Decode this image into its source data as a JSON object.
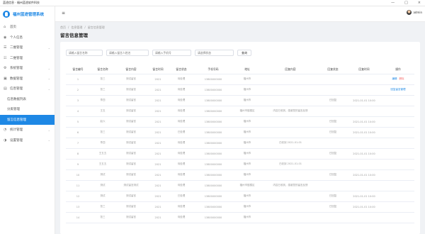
{
  "window": {
    "title": "蓝途信息 · 福州蓝途软件科技",
    "controls": [
      "—",
      "□",
      "×"
    ]
  },
  "app": {
    "name": "福州蓝途管理系统"
  },
  "sidebar": {
    "items": [
      {
        "name": "home",
        "icon": "⌂",
        "label": "首页",
        "chevron": ""
      },
      {
        "name": "personal",
        "icon": "◉",
        "label": "个人信息",
        "chevron": ""
      },
      {
        "name": "menu3",
        "icon": "☰",
        "label": "二维管理",
        "chevron": "⌄"
      },
      {
        "name": "menu4",
        "icon": "☷",
        "label": "二维管理",
        "chevron": ""
      },
      {
        "name": "menu5",
        "icon": "⚙",
        "label": "系统管理",
        "chevron": "⌄"
      },
      {
        "name": "menu6",
        "icon": "▣",
        "label": "数据管理",
        "chevron": "⌄"
      },
      {
        "name": "menu7",
        "icon": "▤",
        "label": "信息管理",
        "chevron": "⌄"
      },
      {
        "name": "sub1",
        "icon": "",
        "label": "信息数据列表",
        "chevron": ""
      },
      {
        "name": "sub2",
        "icon": "",
        "label": "分类管理",
        "chevron": ""
      },
      {
        "name": "sub3",
        "icon": "",
        "label": "留言信息管理",
        "chevron": "",
        "active": true
      },
      {
        "name": "menu8",
        "icon": "◔",
        "label": "统计管理",
        "chevron": "⌄"
      },
      {
        "name": "menu9",
        "icon": "◑",
        "label": "设置管理",
        "chevron": "⌄"
      }
    ]
  },
  "topbar": {
    "menu_icon": "≡",
    "user_name": "admin"
  },
  "breadcrumb": [
    "首页",
    "/",
    "信息管理",
    "/",
    "留言信息管理"
  ],
  "page": {
    "title": "留言信息管理"
  },
  "filters": {
    "inputs": [
      {
        "placeholder": "请输入留言名称"
      },
      {
        "placeholder": "请输入留言人姓名"
      },
      {
        "placeholder": "请输入手机号"
      },
      {
        "placeholder": "请选择状态"
      }
    ],
    "search_label": "查询"
  },
  "table": {
    "columns": [
      "留言编号",
      "留言名称",
      "留言内容",
      "留言时间",
      "留言状态",
      "手机号码",
      "地址",
      "回复内容",
      "回复状态",
      "回复时间",
      "操作"
    ],
    "rows": [
      [
        "1",
        "张三",
        "测试留言",
        "2021",
        "待处理",
        "13800000000",
        "福州市",
        "",
        "",
        "",
        "edit-del"
      ],
      [
        "2",
        "张三",
        "测试留言",
        "2021",
        "待处理",
        "13800000000",
        "福州市",
        "",
        "",
        "",
        "reply"
      ],
      [
        "3",
        "李四",
        "测试留言",
        "2021",
        "待处理",
        "13800000000",
        "福州市",
        "",
        "已回复",
        "2021-01-01 10:00",
        ""
      ],
      [
        "4",
        "王五",
        "测试留言",
        "2021",
        "待处理",
        "13800000000",
        "福州市鼓楼区",
        "内容已收到，感谢您的留言反馈",
        "",
        "",
        ""
      ],
      [
        "5",
        "赵六",
        "测试留言",
        "2021",
        "待处理",
        "13800000000",
        "福州市",
        "",
        "已回复",
        "2021-01-01 10:00",
        ""
      ],
      [
        "6",
        "张三",
        "测试留言",
        "2021",
        "已处理",
        "13800000000",
        "福州市",
        "",
        "已回复",
        "2021-01-01 10:00",
        ""
      ],
      [
        "7",
        "李四",
        "测试留言",
        "2021",
        "待处理",
        "13800000000",
        "福州市",
        "已收到 2021-01-01",
        "",
        "",
        ""
      ],
      [
        "8",
        "王五五",
        "测试留言",
        "2021",
        "待处理",
        "13800000000",
        "福州市",
        "",
        "已回复",
        "2021-01-01 10:00",
        ""
      ],
      [
        "9",
        "王五五",
        "测试留言",
        "2021",
        "待处理",
        "13800000000",
        "福州市",
        "已收到 2021-01-01",
        "",
        "",
        ""
      ],
      [
        "10",
        "测试",
        "测试留言",
        "2021",
        "待处理",
        "13800000000",
        "福州市",
        "",
        "已回复",
        "2021-01-01 10:00",
        ""
      ],
      [
        "11",
        "测试",
        "测试留言测试",
        "2021",
        "待处理",
        "13800000000",
        "福州市鼓楼区",
        "内容已收到，感谢您的留言反馈",
        "",
        "",
        ""
      ],
      [
        "12",
        "测试",
        "测试留言",
        "2021",
        "已处理",
        "13800000000",
        "福州市",
        "",
        "已回复",
        "2021-01-01 10:00",
        ""
      ],
      [
        "13",
        "张三",
        "测试留言",
        "2021",
        "待处理",
        "13800000000",
        "福州市",
        "",
        "已回复",
        "2021-01-01 10:00",
        ""
      ],
      [
        "14",
        "张三",
        "测试留言",
        "2021",
        "待处理",
        "13800000000",
        "福州市",
        "",
        "",
        "",
        ""
      ]
    ],
    "actions": {
      "edit": "编辑",
      "delete": "删除",
      "reply": "回复留言管理"
    }
  },
  "colors": {
    "primary": "#1e88e5",
    "danger": "#f56c6c"
  }
}
